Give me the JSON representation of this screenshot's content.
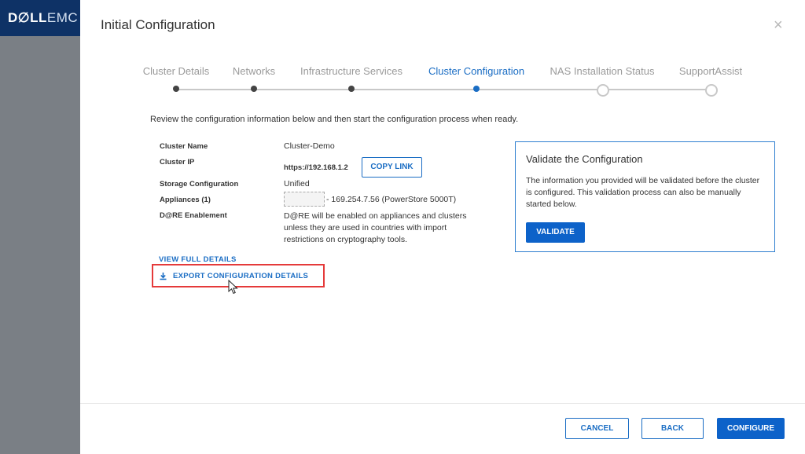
{
  "brand": {
    "dell": "D∅LL",
    "emc": "EMC"
  },
  "dialog": {
    "title": "Initial Configuration",
    "close_symbol": "×"
  },
  "steps": [
    {
      "label": "Cluster Details",
      "state": "done"
    },
    {
      "label": "Networks",
      "state": "done"
    },
    {
      "label": "Infrastructure Services",
      "state": "done"
    },
    {
      "label": "Cluster Configuration",
      "state": "active"
    },
    {
      "label": "NAS Installation Status",
      "state": "pending"
    },
    {
      "label": "SupportAssist",
      "state": "pending"
    }
  ],
  "intro": "Review the configuration information below and then start the configuration process when ready.",
  "details": {
    "cluster_name_label": "Cluster Name",
    "cluster_name_value": "Cluster-Demo",
    "cluster_ip_label": "Cluster IP",
    "cluster_ip_value": "https://192.168.1.2",
    "copy_link_label": "COPY LINK",
    "storage_label": "Storage Configuration",
    "storage_value": "Unified",
    "appliances_label": "Appliances (1)",
    "appliances_value": "- 169.254.7.56 (PowerStore 5000T)",
    "dare_label": "D@RE Enablement",
    "dare_value": "D@RE will be enabled on appliances and clusters unless they are used in countries with import restrictions on cryptography tools."
  },
  "links": {
    "view_full": "VIEW FULL DETAILS",
    "export": "EXPORT CONFIGURATION DETAILS"
  },
  "validate_card": {
    "title": "Validate the Configuration",
    "body": "The information you provided will be validated before the cluster is configured. This validation process can also be manually started below.",
    "button": "VALIDATE"
  },
  "footer": {
    "cancel": "CANCEL",
    "back": "BACK",
    "configure": "CONFIGURE"
  },
  "colors": {
    "accent": "#0d62c9",
    "highlight": "#e53a3a",
    "brand_bg": "#0e3266"
  }
}
